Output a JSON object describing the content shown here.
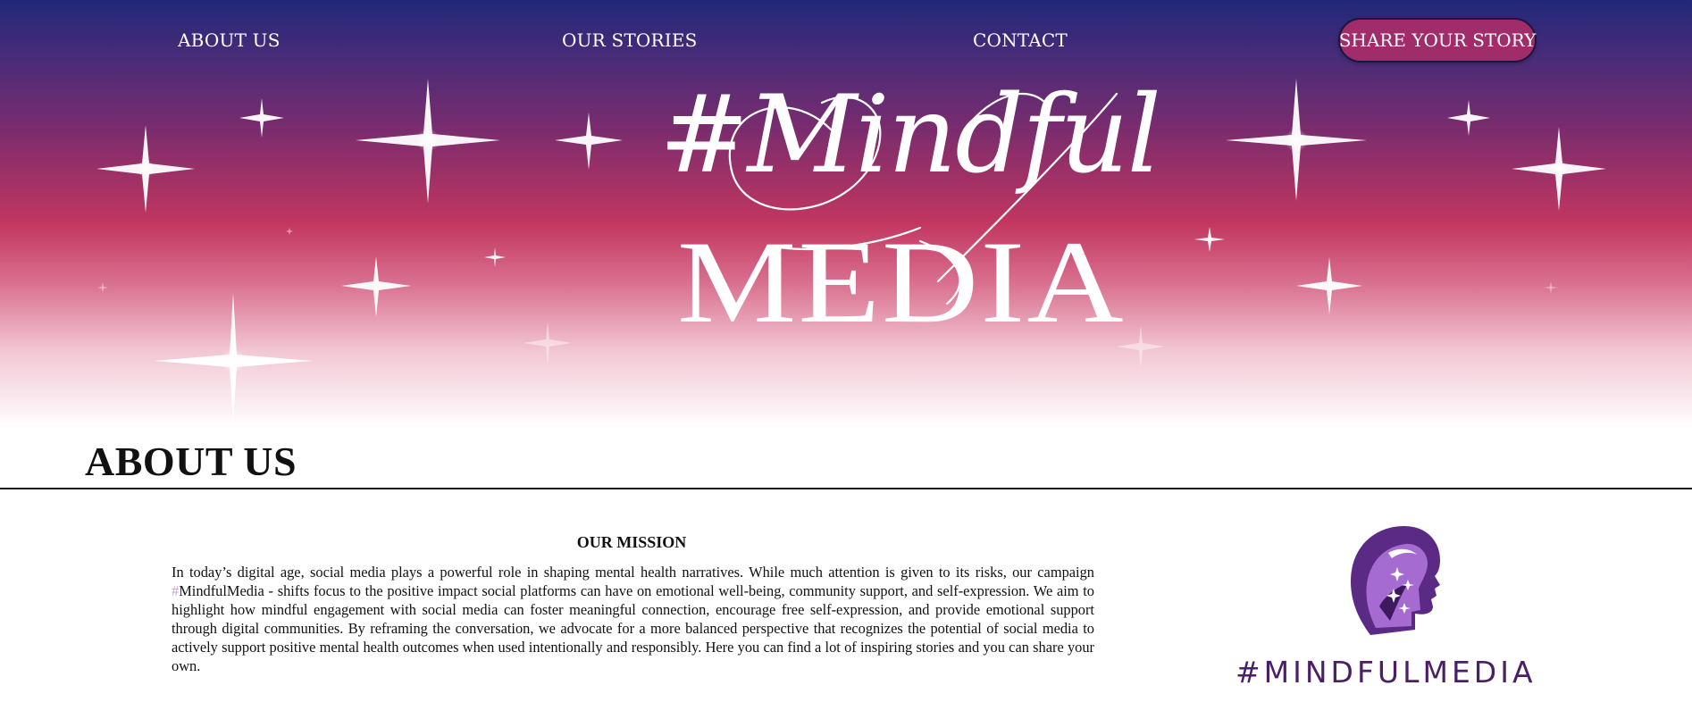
{
  "nav": {
    "about": "ABOUT US",
    "stories": "OUR STORIES",
    "contact": "CONTACT",
    "share": "SHARE YOUR STORY"
  },
  "hero": {
    "logo_script": "#Mindful",
    "logo_media": "MEDIA"
  },
  "about": {
    "heading": "ABOUT US"
  },
  "mission": {
    "title": "OUR MISSION",
    "text_before": "In today’s digital age, social media plays a powerful role in shaping mental health narratives. While much attention is given to its risks, our campaign ",
    "hashtag": "#",
    "text_after": "MindfulMedia - shifts focus to the positive impact social platforms can have on emotional well-being, community support, and self-expression. We aim to highlight how mindful engagement with social media can foster meaningful connection, encourage free self-expression, and provide emotional support through digital communities. By reframing the conversation, we advocate for a more balanced perspective that recognizes the potential of social media to actively support positive mental health outcomes when used intentionally and responsibly. Here you can find a lot of inspiring stories and you can share your own."
  },
  "brand": {
    "wordmark": "#MINDFULMEDIA",
    "emblem_icon": "head-silhouette-icon"
  },
  "colors": {
    "gradient_top": "#22287a",
    "gradient_mid": "#c2365f",
    "button": "#a02d6a",
    "wordmark": "#4a1f68",
    "emblem": "#7b3fa6"
  }
}
